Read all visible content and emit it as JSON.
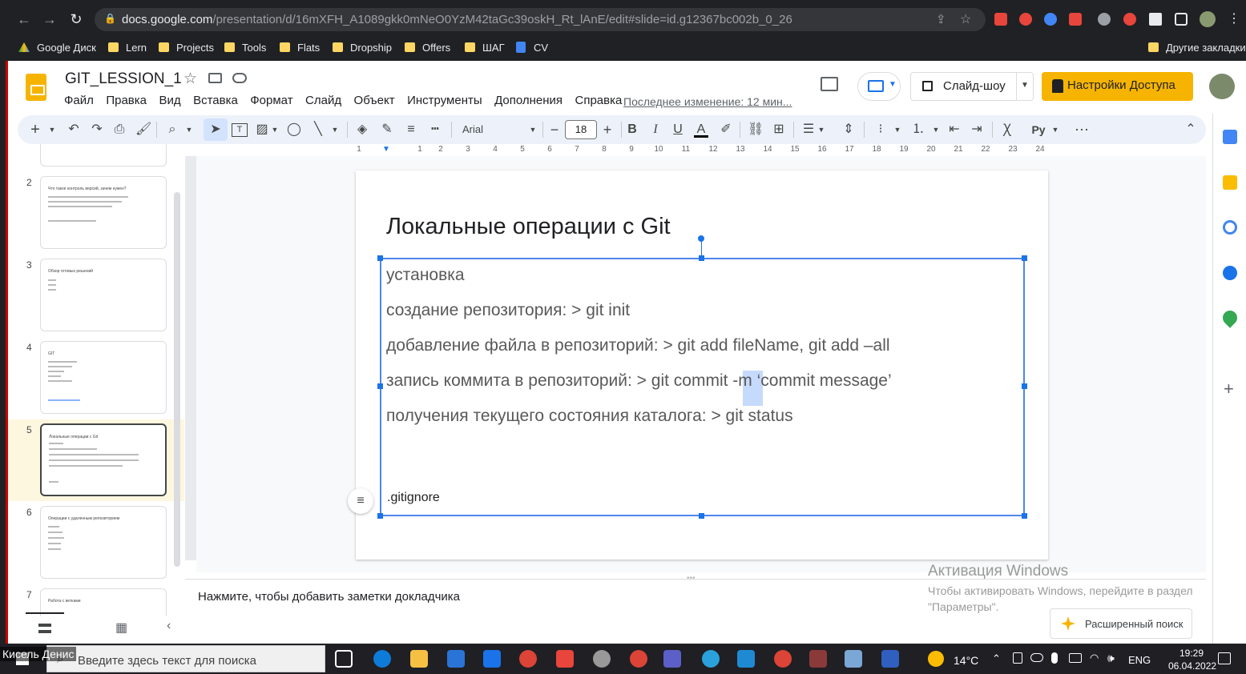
{
  "browser": {
    "url_host": "docs.google.com",
    "url_path": "/presentation/d/16mXFH_A1089gkk0mNeO0YzM42taGc39oskH_Rt_lAnE/edit#slide=id.g12367bc002b_0_26",
    "bookmarks": [
      "Google Диск",
      "Lern",
      "Projects",
      "Tools",
      "Flats",
      "Dropship",
      "Offers",
      "ШАГ",
      "CV"
    ],
    "other_bookmarks": "Другие закладки"
  },
  "app": {
    "doc_title": "GIT_LESSION_1",
    "menus": [
      "Файл",
      "Правка",
      "Вид",
      "Вставка",
      "Формат",
      "Слайд",
      "Объект",
      "Инструменты",
      "Дополнения",
      "Справка"
    ],
    "last_edit": "Последнее изменение: 12 мин...",
    "slideshow_label": "Слайд-шоу",
    "share_label": "Настройки Доступа"
  },
  "toolbar": {
    "font_name": "Arial",
    "font_size": "18"
  },
  "ruler": {
    "numbers": [
      "1",
      "1",
      "2",
      "3",
      "4",
      "5",
      "6",
      "7",
      "8",
      "9",
      "10",
      "11",
      "12",
      "13",
      "14",
      "15",
      "16",
      "17",
      "18",
      "19",
      "20",
      "21",
      "22",
      "23",
      "24"
    ]
  },
  "filmstrip": {
    "slides": [
      {
        "num": "2",
        "title": "Что такое контроль версий, зачем нужен?"
      },
      {
        "num": "3",
        "title": "Обзор готовых решений"
      },
      {
        "num": "4",
        "title": "GIT"
      },
      {
        "num": "5",
        "title": "Локальные операции с Git"
      },
      {
        "num": "6",
        "title": "Операции с удаленным репозиторием"
      },
      {
        "num": "7",
        "title": "Работа с ветками"
      }
    ]
  },
  "slide": {
    "title": "Локальные операции с Git",
    "lines": [
      "установка",
      "создание репозитория: > git init",
      "добавление файла в репозиторий: > git add fileName, git add –all",
      "запись коммита в репозиторий: > git commit -m ‘commit message’",
      "получения текущего состояния каталога: > git status"
    ],
    "footer_line": ".gitignore"
  },
  "notes": {
    "placeholder": "Нажмите, чтобы добавить заметки докладчика"
  },
  "windows_overlay": {
    "title": "Активация Windows",
    "subtitle": "Чтобы активировать Windows, перейдите в раздел \"Параметры\"."
  },
  "explore_button": "Расширенный поиск",
  "taskbar": {
    "search_placeholder": "Введите здесь текст для поиска",
    "temperature": "14°C",
    "language": "ENG",
    "time": "19:29",
    "date": "06.04.2022"
  },
  "presenter_name": "Кисель Денис",
  "colors": {
    "accent_yellow": "#f6b400",
    "selection_blue": "#4f86ec",
    "chrome_dark": "#202124"
  }
}
